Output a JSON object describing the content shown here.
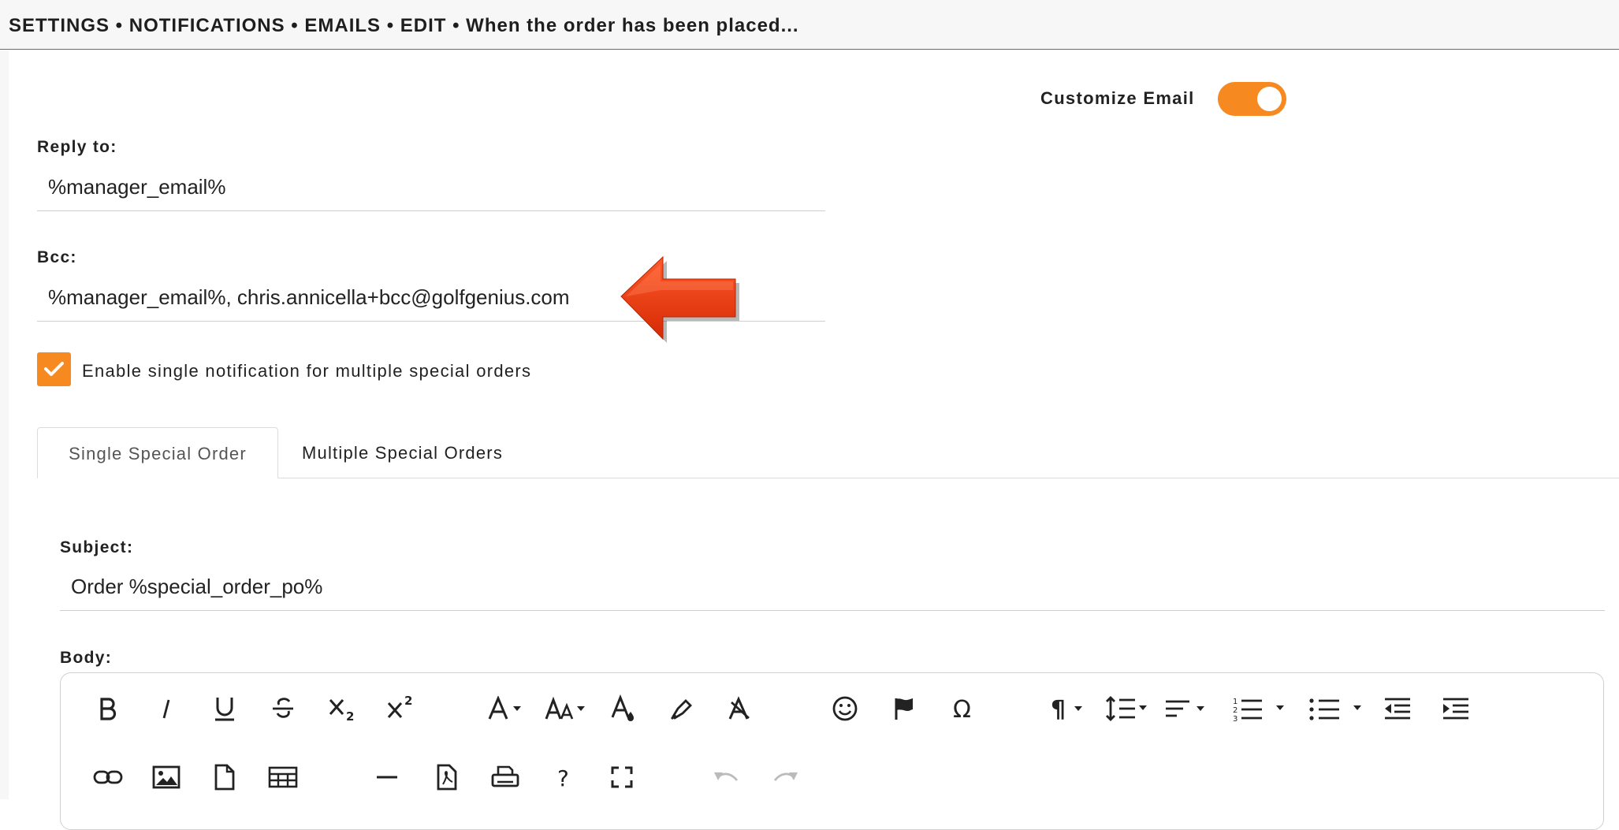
{
  "breadcrumb": {
    "text": "SETTINGS • NOTIFICATIONS • EMAILS • EDIT • When the order has been placed..."
  },
  "customize": {
    "label": "Customize Email",
    "enabled": true,
    "accent_color": "#f6891f"
  },
  "reply_to": {
    "label": "Reply to:",
    "value": "%manager_email%"
  },
  "bcc": {
    "label": "Bcc:",
    "value": "%manager_email%, chris.annicella+bcc@golfgenius.com"
  },
  "annotation": {
    "icon": "red-arrow-icon",
    "color": "#e8380d"
  },
  "single_notification": {
    "label": "Enable single notification for multiple special orders",
    "checked": true
  },
  "tabs": [
    {
      "label": "Single Special Order",
      "active": true
    },
    {
      "label": "Multiple Special Orders",
      "active": false
    }
  ],
  "subject": {
    "label": "Subject:",
    "value": "Order %special_order_po%"
  },
  "body": {
    "label": "Body:"
  },
  "toolbar": {
    "row1": [
      "bold-icon",
      "italic-icon",
      "underline-icon",
      "strikethrough-icon",
      "subscript-icon",
      "superscript-icon",
      "font-family-icon",
      "font-size-icon",
      "text-color-icon",
      "background-color-icon",
      "clear-formatting-icon",
      "emoticons-icon",
      "flag-icon",
      "special-characters-icon",
      "paragraph-format-icon",
      "line-height-icon",
      "align-icon",
      "ordered-list-icon",
      "unordered-list-icon",
      "outdent-icon",
      "indent-icon"
    ],
    "row2": [
      "insert-link-icon",
      "insert-image-icon",
      "insert-file-icon",
      "insert-table-icon",
      "horizontal-line-icon",
      "pdf-icon",
      "print-icon",
      "help-icon",
      "fullscreen-icon",
      "undo-icon",
      "redo-icon"
    ],
    "subscript_label": "2",
    "superscript_label": "2",
    "help_label": "?",
    "omega_label": "Ω",
    "pilcrow_label": "¶"
  }
}
